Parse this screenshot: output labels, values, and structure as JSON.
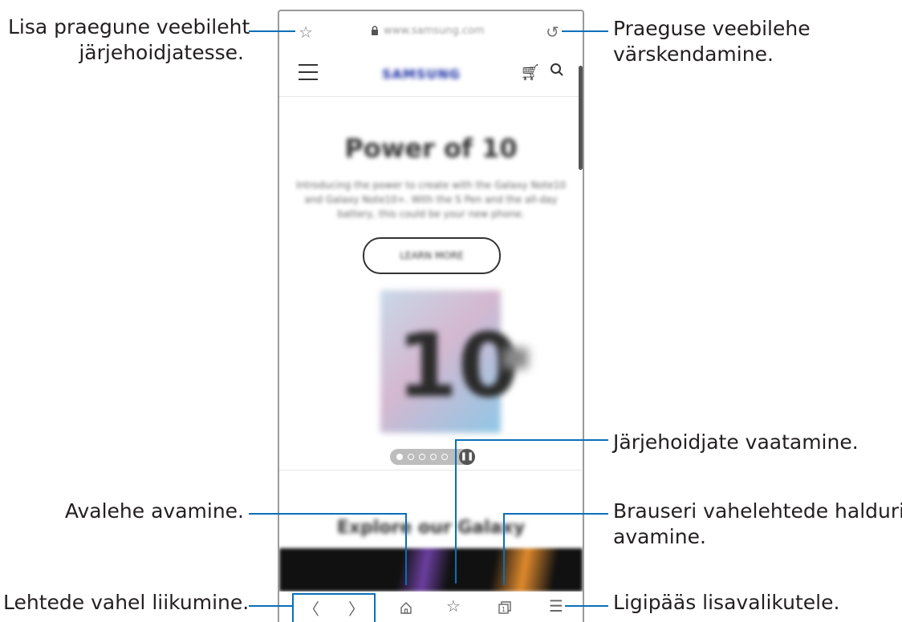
{
  "callouts": {
    "bookmark_add": [
      "Lisa praegune veebileht",
      "järjehoidjatesse."
    ],
    "reload": [
      "Praeguse veebilehe",
      "värskendamine."
    ],
    "bookmarks_view": "Järjehoidjate vaatamine.",
    "home_open": "Avalehe avamine.",
    "tab_manager": [
      "Brauseri vahelehtede halduri",
      "avamine."
    ],
    "navigate": "Lehtede vahel liikumine.",
    "more_options": "Ligipääs lisavalikutele."
  },
  "browser": {
    "url": "www.samsung.com",
    "site": {
      "brand": "SAMSUNG",
      "hero_title": "Power of 10",
      "hero_text": "Introducing the power to create with the Galaxy Note10 and Galaxy Note10+. With the S Pen and the all-day battery, this could be your new phone.",
      "cta": "LEARN MORE",
      "promo_number": "10",
      "section_title": "Explore our Galaxy"
    },
    "icons": {
      "bookmark_add": "star-outline-icon",
      "reload": "reload-icon",
      "menu": "hamburger-icon",
      "cart": "cart-icon",
      "search": "search-icon",
      "back": "chevron-left-icon",
      "forward": "chevron-right-icon",
      "home": "home-icon",
      "bookmarks": "bookmarks-icon",
      "tabs": "tabs-icon",
      "more": "more-menu-icon"
    },
    "tab_count": "1"
  },
  "colors": {
    "callout_line": "#0a6fb7",
    "brand": "#1428a0"
  }
}
